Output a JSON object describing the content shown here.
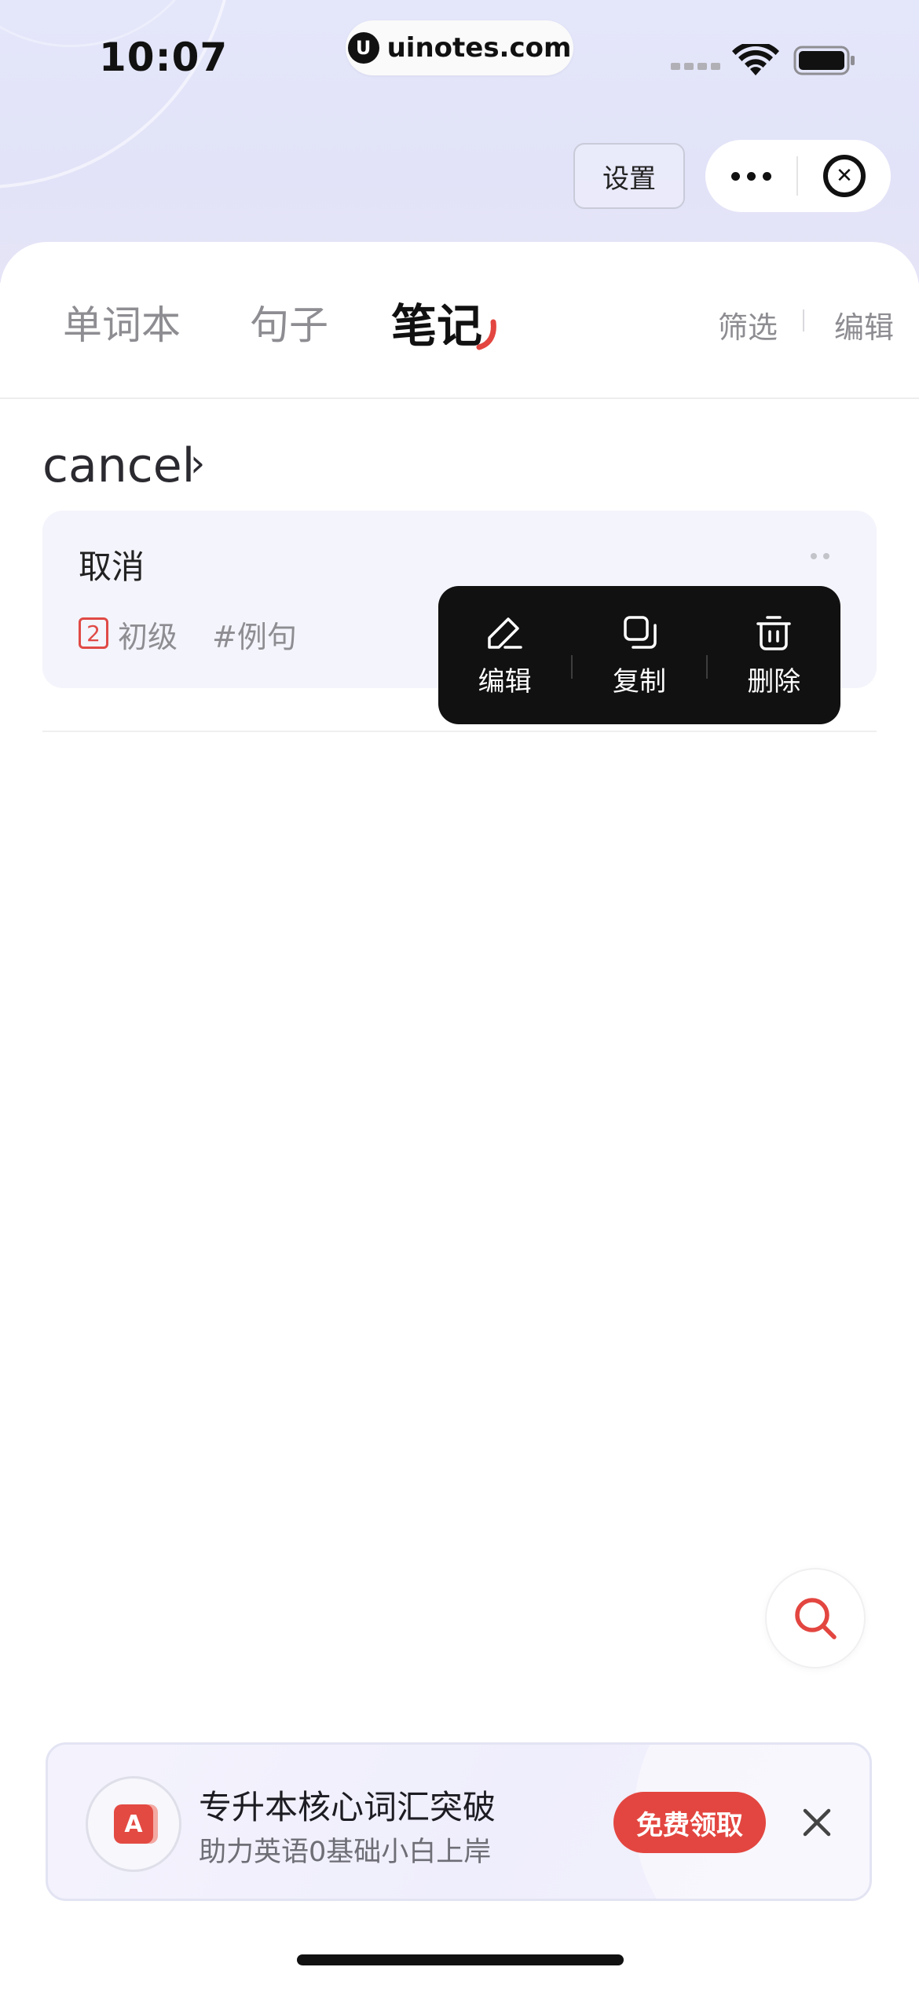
{
  "status_bar": {
    "time": "10:07",
    "url": "uinotes.com",
    "url_logo": "U"
  },
  "header": {
    "settings_label": "设置"
  },
  "tabs": [
    {
      "label": "单词本"
    },
    {
      "label": "句子"
    },
    {
      "label": "笔记",
      "active": true
    }
  ],
  "actions": {
    "filter_label": "筛选",
    "edit_label": "编辑"
  },
  "note_group": {
    "word": "cancel",
    "chevron": "›",
    "note": {
      "text": "取消",
      "level_number": "2",
      "level_label": "初级",
      "tag_label": "#例句"
    }
  },
  "popup_menu": [
    {
      "label": "编辑",
      "icon": "pencil-icon"
    },
    {
      "label": "复制",
      "icon": "copy-icon"
    },
    {
      "label": "删除",
      "icon": "trash-icon"
    }
  ],
  "promo": {
    "logo_letter": "A",
    "title": "专升本核心词汇突破",
    "subtitle": "助力英语0基础小白上岸",
    "button_label": "免费领取"
  },
  "colors": {
    "accent": "#e34640",
    "text_primary": "#111111",
    "text_secondary": "#8d8d92",
    "card_bg": "#f4f4fc"
  }
}
